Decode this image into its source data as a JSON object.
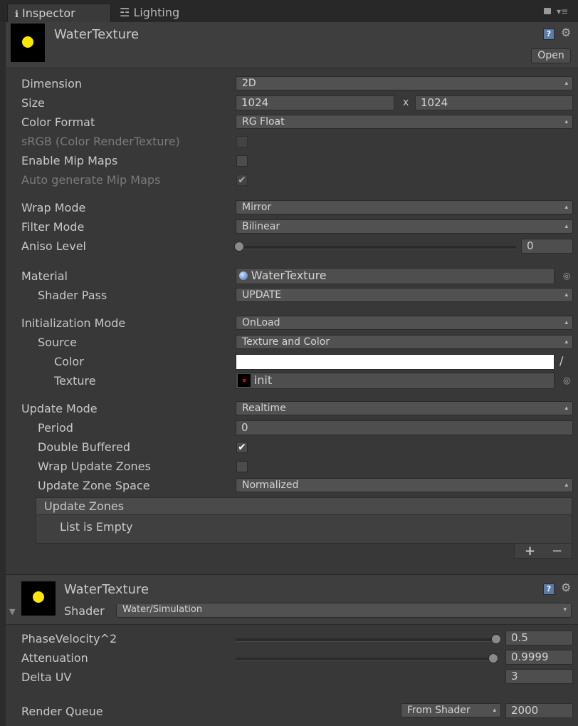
{
  "tabs": {
    "inspector": "Inspector",
    "lighting": "Lighting"
  },
  "header1": {
    "title": "WaterTexture",
    "open": "Open"
  },
  "rt": {
    "dimension": {
      "label": "Dimension",
      "value": "2D"
    },
    "size": {
      "label": "Size",
      "w": "1024",
      "x": "x",
      "h": "1024"
    },
    "color_format": {
      "label": "Color Format",
      "value": "RG Float"
    },
    "srgb": {
      "label": "sRGB (Color RenderTexture)"
    },
    "mip": {
      "label": "Enable Mip Maps"
    },
    "auto_mip": {
      "label": "Auto generate Mip Maps"
    },
    "wrap": {
      "label": "Wrap Mode",
      "value": "Mirror"
    },
    "filter": {
      "label": "Filter Mode",
      "value": "Bilinear"
    },
    "aniso": {
      "label": "Aniso Level",
      "value": "0"
    }
  },
  "crt": {
    "material": {
      "label": "Material",
      "value": "WaterTexture"
    },
    "shader_pass": {
      "label": "Shader Pass",
      "value": "UPDATE"
    },
    "init_mode": {
      "label": "Initialization Mode",
      "value": "OnLoad"
    },
    "source": {
      "label": "Source",
      "value": "Texture and Color"
    },
    "color": {
      "label": "Color",
      "value": "#ffffff"
    },
    "texture": {
      "label": "Texture",
      "value": "init"
    },
    "update_mode": {
      "label": "Update Mode",
      "value": "Realtime"
    },
    "period": {
      "label": "Period",
      "value": "0"
    },
    "double_buffered": {
      "label": "Double Buffered"
    },
    "wrap_zones": {
      "label": "Wrap Update Zones"
    },
    "zone_space": {
      "label": "Update Zone Space",
      "value": "Normalized"
    },
    "zones": {
      "title": "Update Zones",
      "empty": "List is Empty",
      "add": "+",
      "remove": "−"
    }
  },
  "material": {
    "title": "WaterTexture",
    "shader_label": "Shader",
    "shader_value": "Water/Simulation",
    "phase": {
      "label": "PhaseVelocity^2",
      "value": "0.5"
    },
    "atten": {
      "label": "Attenuation",
      "value": "0.9999"
    },
    "delta": {
      "label": "Delta UV",
      "value": "3"
    },
    "queue": {
      "label": "Render Queue",
      "mode": "From Shader",
      "value": "2000"
    }
  },
  "colors": {
    "accent_yellow": "#ffe800",
    "background": "#383838"
  }
}
